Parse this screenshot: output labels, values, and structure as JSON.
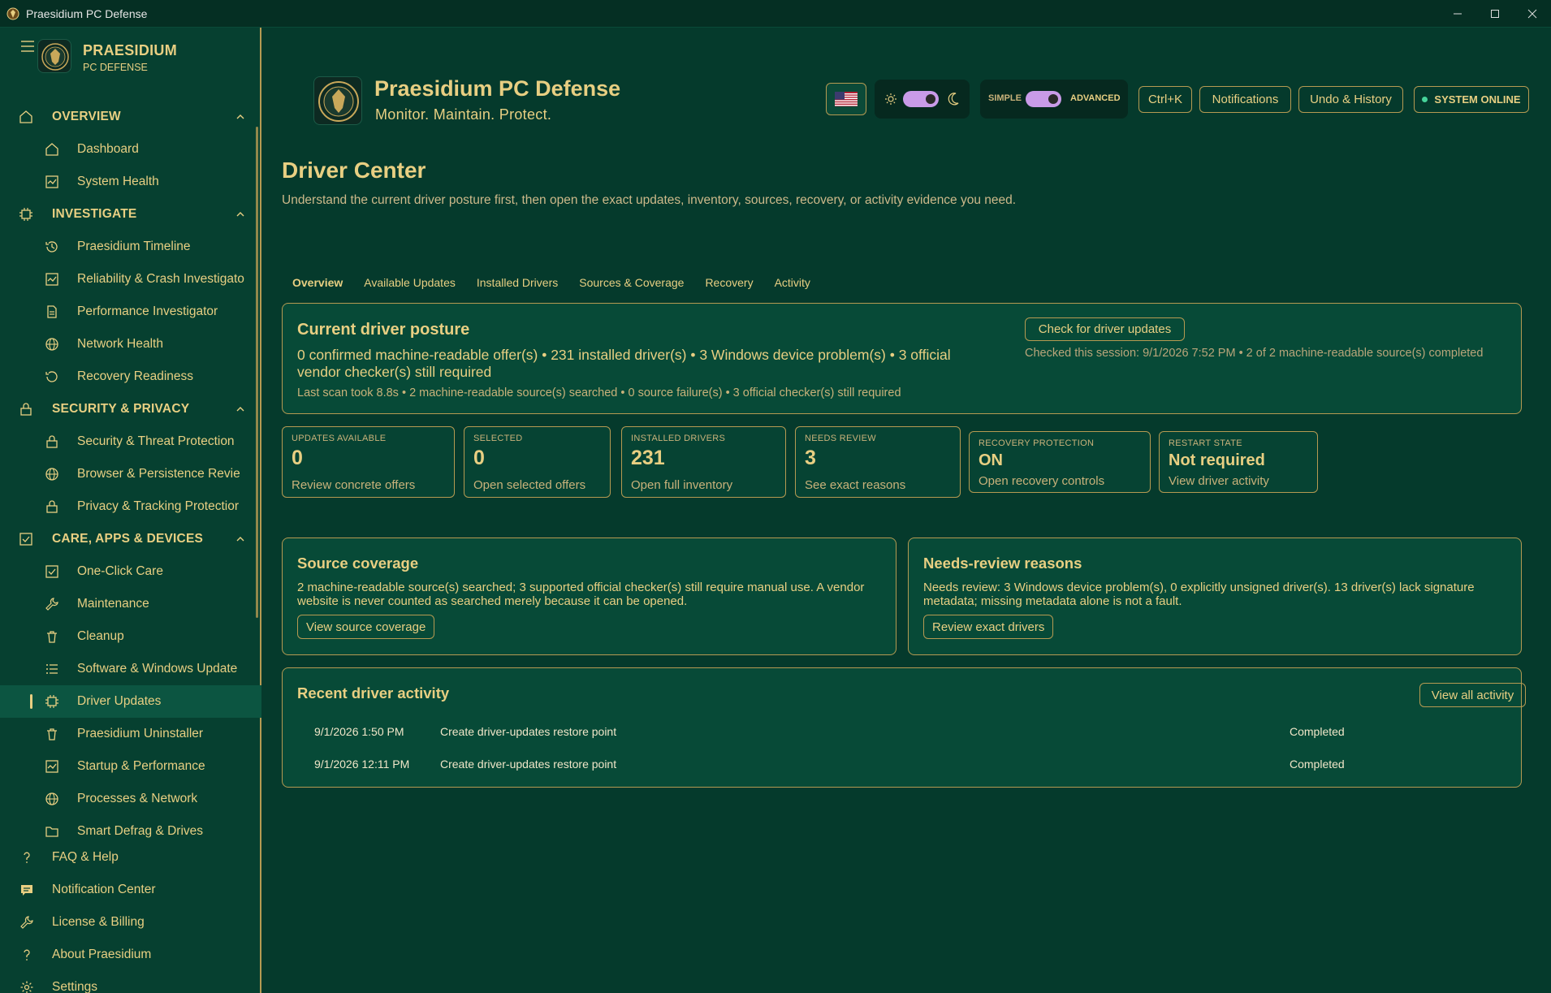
{
  "window": {
    "title": "Praesidium PC Defense"
  },
  "brand": {
    "name": "PRAESIDIUM",
    "sub": "PC DEFENSE"
  },
  "nav": {
    "sections": [
      {
        "label": "OVERVIEW",
        "items": [
          "Dashboard",
          "System Health"
        ]
      },
      {
        "label": "INVESTIGATE",
        "items": [
          "Praesidium Timeline",
          "Reliability & Crash Investigato",
          "Performance Investigator",
          "Network Health",
          "Recovery Readiness"
        ]
      },
      {
        "label": "SECURITY & PRIVACY",
        "items": [
          "Security & Threat Protection",
          "Browser & Persistence Revie",
          "Privacy & Tracking Protectior"
        ]
      },
      {
        "label": "CARE, APPS & DEVICES",
        "items": [
          "One-Click Care",
          "Maintenance",
          "Cleanup",
          "Software & Windows Update",
          "Driver Updates",
          "Praesidium Uninstaller",
          "Startup & Performance",
          "Processes & Network",
          "Smart Defrag & Drives"
        ]
      }
    ],
    "bottom": [
      "FAQ & Help",
      "Notification Center",
      "License & Billing",
      "About Praesidium",
      "Settings"
    ]
  },
  "header": {
    "title": "Praesidium PC Defense",
    "tagline": "Monitor. Maintain. Protect.",
    "mode_simple": "SIMPLE",
    "mode_advanced": "ADVANCED",
    "ctrlk": "Ctrl+K",
    "notifications": "Notifications",
    "undo": "Undo & History",
    "status": "SYSTEM ONLINE"
  },
  "page": {
    "title": "Driver Center",
    "description": "Understand the current driver posture first, then open the exact updates, inventory, sources, recovery, or activity evidence you need.",
    "tabs": [
      "Overview",
      "Available Updates",
      "Installed Drivers",
      "Sources & Coverage",
      "Recovery",
      "Activity"
    ]
  },
  "posture": {
    "title": "Current driver posture",
    "summary": "0 confirmed machine-readable offer(s) • 231 installed driver(s) • 3 Windows device problem(s) • 3 official vendor checker(s) still required",
    "scan": "Last scan took 8.8s • 2 machine-readable source(s) searched • 0 source failure(s) • 3 official checker(s) still required",
    "check_btn": "Check for driver updates",
    "checked": "Checked this session: 9/1/2026 7:52 PM • 2 of 2 machine-readable source(s) completed"
  },
  "stats": [
    {
      "key": "UPDATES AVAILABLE",
      "value": "0",
      "link": "Review concrete offers"
    },
    {
      "key": "SELECTED",
      "value": "0",
      "link": "Open selected offers"
    },
    {
      "key": "INSTALLED DRIVERS",
      "value": "231",
      "link": "Open full inventory"
    },
    {
      "key": "NEEDS REVIEW",
      "value": "3",
      "link": "See exact reasons"
    },
    {
      "key": "RECOVERY PROTECTION",
      "value": "ON",
      "link": "Open recovery controls"
    },
    {
      "key": "RESTART STATE",
      "value": "Not required",
      "link": "View driver activity"
    }
  ],
  "coverage": {
    "title": "Source coverage",
    "text": "2 machine-readable source(s) searched; 3 supported official checker(s) still require manual use. A vendor website is never counted as searched merely because it can be opened.",
    "button": "View source coverage"
  },
  "review": {
    "title": "Needs-review reasons",
    "text": "Needs review: 3 Windows device problem(s), 0 explicitly unsigned driver(s). 13 driver(s) lack signature metadata; missing metadata alone is not a fault.",
    "button": "Review exact drivers"
  },
  "activity": {
    "title": "Recent driver activity",
    "button": "View all activity",
    "rows": [
      {
        "date": "9/1/2026 1:50 PM",
        "task": "Create driver-updates restore point",
        "status": "Completed"
      },
      {
        "date": "9/1/2026 12:11 PM",
        "task": "Create driver-updates restore point",
        "status": "Completed"
      }
    ]
  },
  "colors": {
    "background": "#053a2c",
    "card": "#074a37",
    "gold": "#e8cf82",
    "border": "#b59a52",
    "toggle": "#c99be8",
    "online": "#46d39a"
  }
}
